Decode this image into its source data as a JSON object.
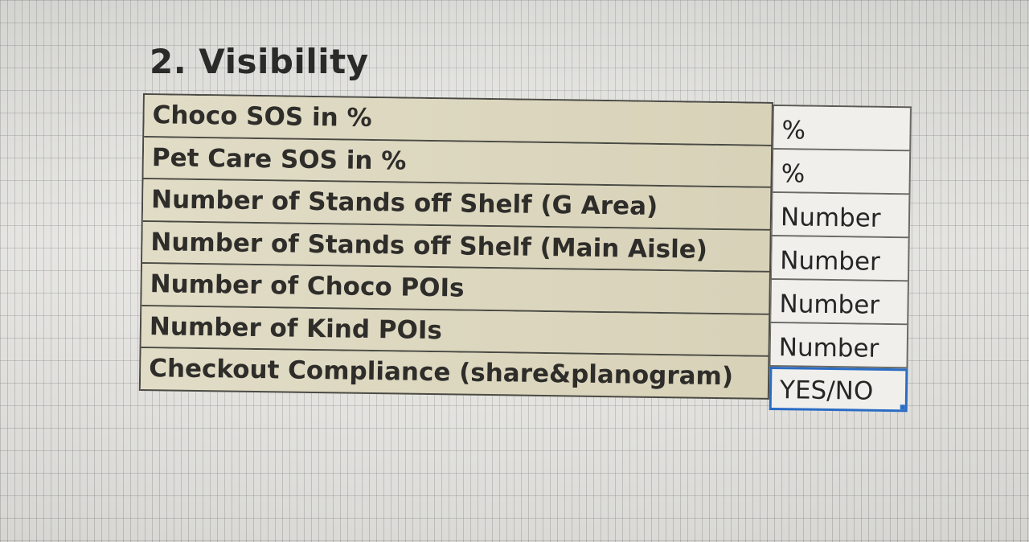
{
  "section": {
    "title": "2. Visibility"
  },
  "rows": [
    {
      "label": "Choco SOS in %",
      "value": "%"
    },
    {
      "label": "Pet Care SOS in %",
      "value": "%"
    },
    {
      "label": "Number of Stands off Shelf (G Area)",
      "value": "Number"
    },
    {
      "label": "Number of Stands off Shelf (Main Aisle)",
      "value": "Number"
    },
    {
      "label": "Number of Choco POIs",
      "value": "Number"
    },
    {
      "label": "Number of Kind POIs",
      "value": "Number"
    },
    {
      "label": "Checkout Compliance (share&planogram)",
      "value": "YES/NO"
    }
  ],
  "colors": {
    "label_fill": "#dcd6bc",
    "value_fill": "#f0efeb",
    "selection": "#2b6cc4"
  }
}
